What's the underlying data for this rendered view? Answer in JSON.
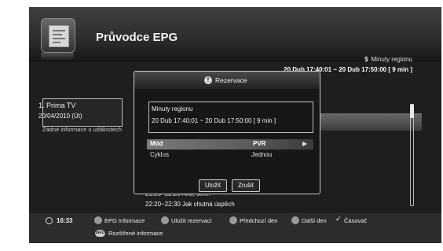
{
  "header": {
    "title": "Průvodce EPG",
    "region_title": "Minuty regionu",
    "region_icon": "$",
    "region_time": "20 Dub 17:40:01 ~ 20 Dub 17:50:00 [ 9 min ]"
  },
  "channel": {
    "name": "1. Prima TV",
    "date": "20/04/2010 (Út)",
    "no_info": "Žádné informace o událostech"
  },
  "programs": [
    "21:20~22:20 Ano, šéfe!",
    "22:20~22:30 Jak chutná úspěch"
  ],
  "dialog": {
    "title": "Rezervace",
    "icon": "!",
    "info_title": "Minuty regionu",
    "info_range": "20 Dub 17:40:01 ~ 20 Dub 17:50:00 [ 9 min ]",
    "mode_label": "Mód",
    "mode_value": "PVR",
    "mode_arrow": "▶",
    "cycle_label": "Cyklus",
    "cycle_value": "Jednou",
    "save_label": "Uložit",
    "cancel_label": "Zrušit"
  },
  "footer": {
    "time": "16:33",
    "epg_info": "EPG Informace",
    "save_reservation": "Uložit rezervaci",
    "prev_day": "Předchozí den",
    "next_day": "Další den",
    "check_mark": "✓",
    "timer": "Časovač",
    "info_icon_label": "INFO",
    "extended_info": "Rozšířené informace"
  }
}
